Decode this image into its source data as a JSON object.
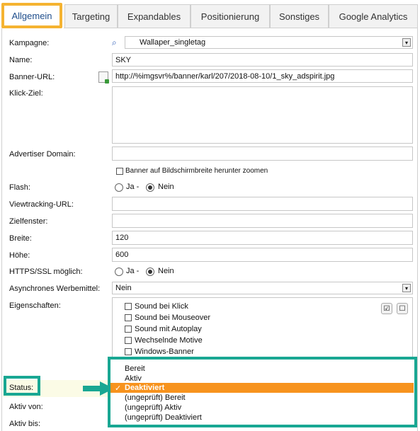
{
  "tabs": [
    {
      "label": "Allgemein",
      "active": true
    },
    {
      "label": "Targeting"
    },
    {
      "label": "Expandables"
    },
    {
      "label": "Positionierung"
    },
    {
      "label": "Sonstiges"
    },
    {
      "label": "Google Analytics"
    }
  ],
  "form": {
    "kampagne": {
      "label": "Kampagne:",
      "value": "Wallaper_singletag"
    },
    "name": {
      "label": "Name:",
      "value": "SKY"
    },
    "banner_url": {
      "label": "Banner-URL:",
      "value": "http://%imgsvr%/banner/karl/207/2018-08-10/1_sky_adspirit.jpg"
    },
    "klick_ziel": {
      "label": "Klick-Ziel:",
      "value": ""
    },
    "advertiser_domain": {
      "label": "Advertiser Domain:",
      "value": ""
    },
    "zoom_checkbox": {
      "label": "Banner auf Bildschirmbreite herunter zoomen"
    },
    "flash": {
      "label": "Flash:",
      "ja": "Ja -",
      "nein": "Nein"
    },
    "viewtracking": {
      "label": "Viewtracking-URL:",
      "value": ""
    },
    "zielfenster": {
      "label": "Zielfenster:",
      "value": ""
    },
    "breite": {
      "label": "Breite:",
      "value": "120"
    },
    "hoehe": {
      "label": "Höhe:",
      "value": "600"
    },
    "https": {
      "label": "HTTPS/SSL möglich:",
      "ja": "Ja -",
      "nein": "Nein"
    },
    "async": {
      "label": "Asynchrones Werbemittel:",
      "value": "Nein"
    },
    "eigenschaften": {
      "label": "Eigenschaften:",
      "items": [
        "Sound bei Klick",
        "Sound bei Mouseover",
        "Sound mit Autoplay",
        "Wechselnde Motive",
        "Windows-Banner"
      ],
      "check_all_icon": "☑",
      "uncheck_icon": "☐"
    },
    "status": {
      "label": "Status:"
    },
    "aktiv_von": {
      "label": "Aktiv von:"
    },
    "aktiv_bis": {
      "label": "Aktiv bis:"
    }
  },
  "status_dropdown": {
    "options": [
      "Bereit",
      "Aktiv",
      "Deaktiviert",
      "(ungeprüft) Bereit",
      "(ungeprüft) Aktiv",
      "(ungeprüft) Deaktiviert"
    ],
    "selected": "Deaktiviert",
    "check_mark": "✓"
  },
  "icons": {
    "search": "⌕",
    "select_arrow": "▾"
  },
  "colors": {
    "tab_highlight": "#f5b331",
    "annotation_teal": "#19a793",
    "selected_option": "#f7931e",
    "tab_text_active": "#1f4e8c"
  }
}
